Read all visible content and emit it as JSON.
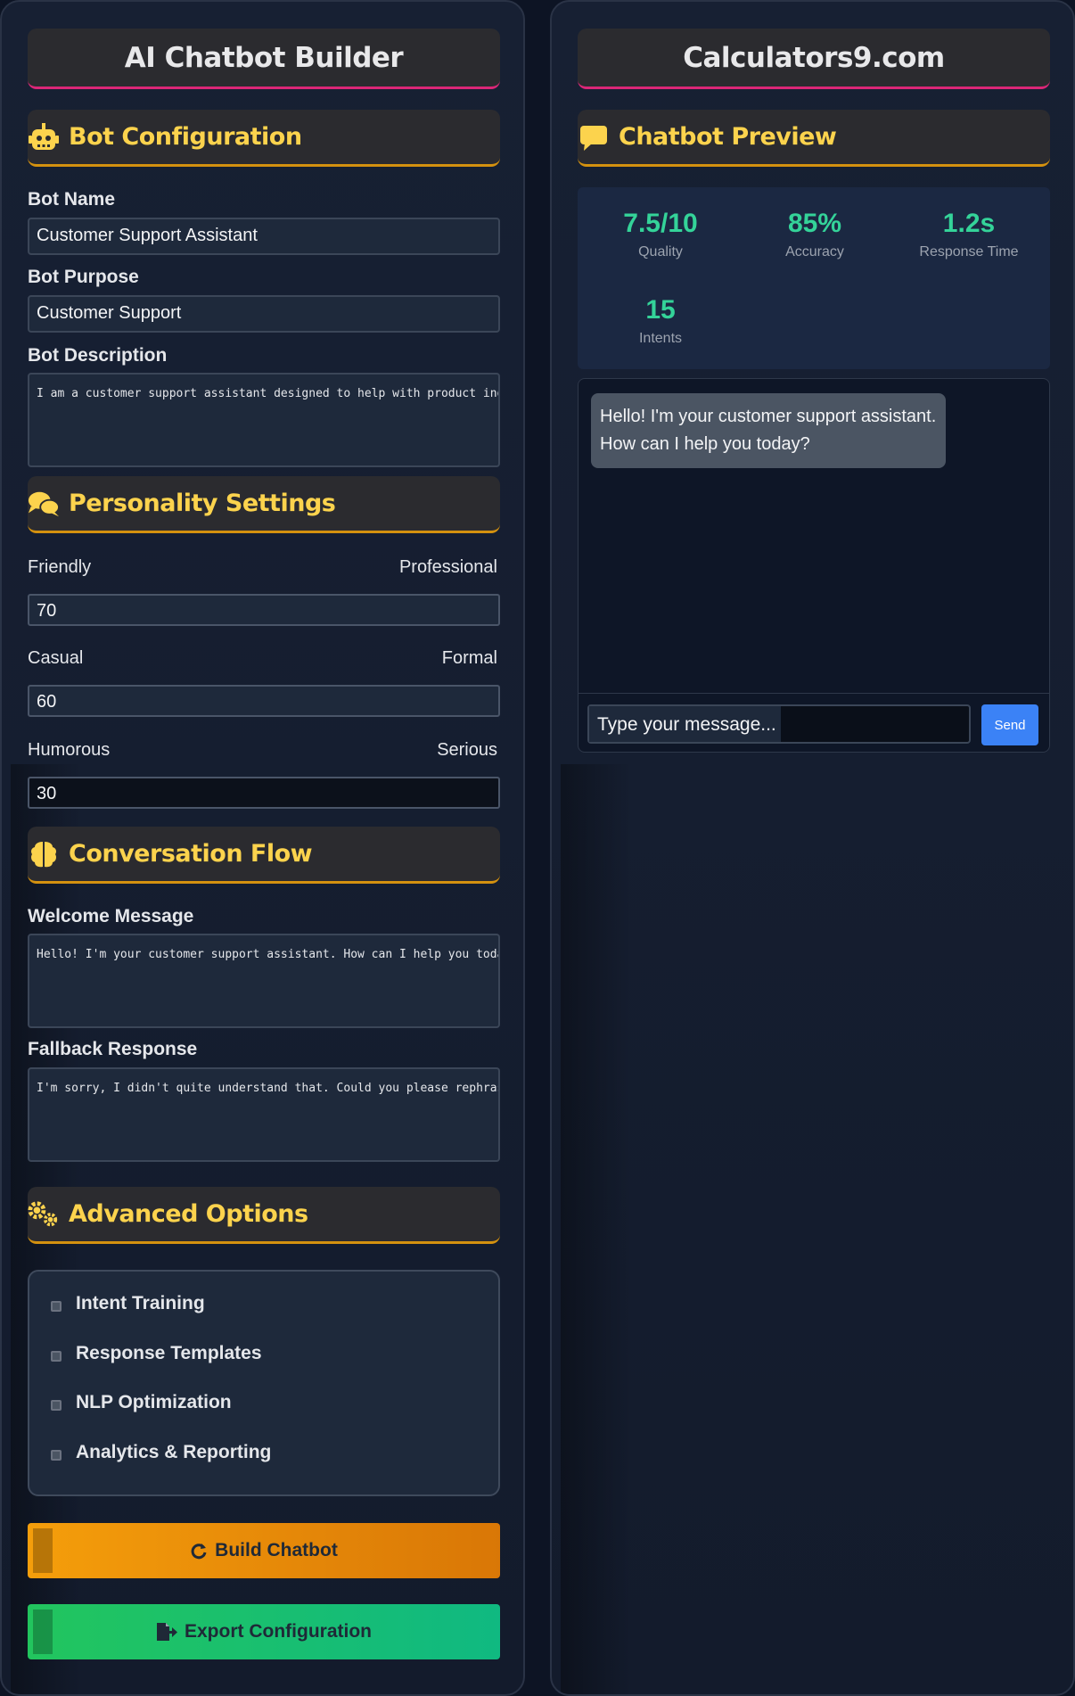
{
  "builder": {
    "title": "AI Chatbot Builder",
    "sections": {
      "bot_config": "Bot Configuration",
      "personality": "Personality Settings",
      "conversation_flow": "Conversation Flow",
      "advanced": "Advanced Options"
    },
    "bot_name": {
      "label": "Bot Name",
      "value": "Customer Support Assistant"
    },
    "bot_purpose": {
      "label": "Bot Purpose",
      "value": "Customer Support"
    },
    "bot_description": {
      "label": "Bot Description",
      "value": "I am a customer support assistant designed to help with product inq"
    },
    "sliders": [
      {
        "left": "Friendly",
        "right": "Professional",
        "value": "70"
      },
      {
        "left": "Casual",
        "right": "Formal",
        "value": "60"
      },
      {
        "left": "Humorous",
        "right": "Serious",
        "value": "30"
      }
    ],
    "welcome": {
      "label": "Welcome Message",
      "value": "Hello! I'm your customer support assistant. How can I help you toda"
    },
    "fallback": {
      "label": "Fallback Response",
      "value": "I'm sorry, I didn't quite understand that. Could you please rephras"
    },
    "options": [
      "Intent Training",
      "Response Templates",
      "NLP Optimization",
      "Analytics & Reporting"
    ],
    "build_label": "Build Chatbot",
    "export_label": "Export Configuration"
  },
  "preview": {
    "title": "Calculators9.com",
    "section": "Chatbot Preview",
    "stats": [
      {
        "value": "7.5/10",
        "label": "Quality"
      },
      {
        "value": "85%",
        "label": "Accuracy"
      },
      {
        "value": "1.2s",
        "label": "Response Time"
      },
      {
        "value": "15",
        "label": "Intents"
      }
    ],
    "bot_message": "Hello! I'm your customer support assistant. How can I help you today?",
    "input_placeholder": "Type your message...",
    "send_label": "Send"
  },
  "colors": {
    "accent_yellow": "#fcd34d",
    "stat_green": "#34d399",
    "build_orange": "#f59e0b",
    "export_green": "#22c55e",
    "send_blue": "#3b82f6"
  }
}
